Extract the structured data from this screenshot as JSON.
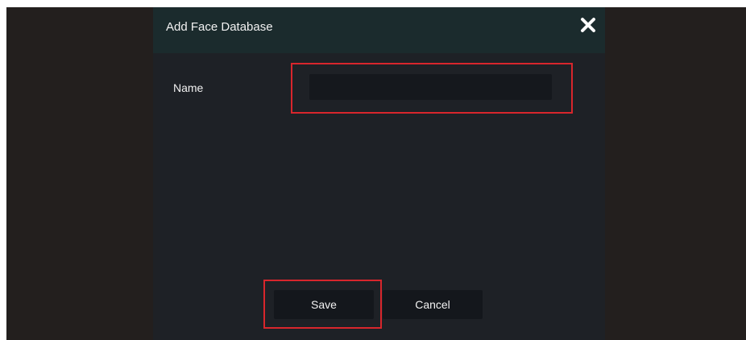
{
  "dialog": {
    "title": "Add Face Database",
    "close_icon": "close-icon"
  },
  "form": {
    "name_label": "Name",
    "name_value": ""
  },
  "buttons": {
    "save_label": "Save",
    "cancel_label": "Cancel"
  },
  "colors": {
    "backdrop": "#231f1e",
    "dialog_body": "#1e2126",
    "dialog_header": "#1b2b2d",
    "input_bg": "#15181d",
    "button_bg": "#14171c",
    "highlight": "#d8262c",
    "text": "#f2f2f2"
  }
}
